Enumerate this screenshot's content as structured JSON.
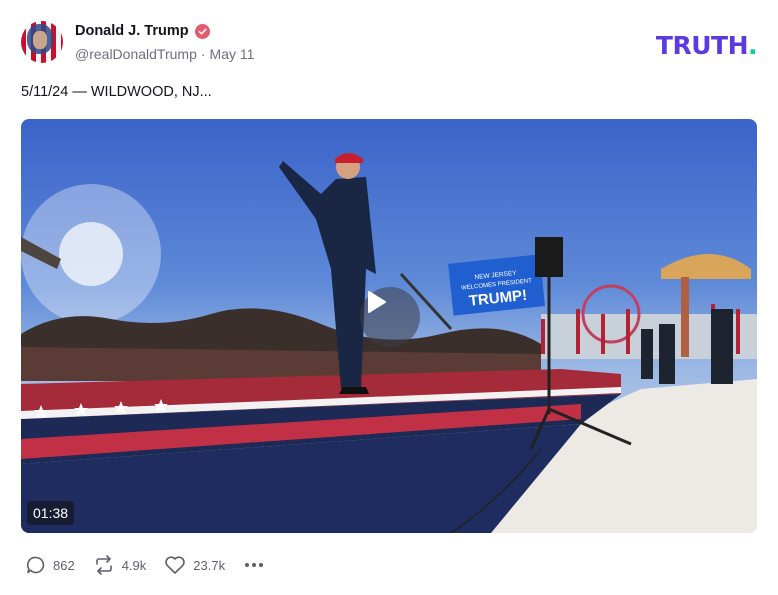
{
  "post": {
    "author_name": "Donald J. Trump",
    "handle": "@realDonaldTrump",
    "separator": "·",
    "date": "May 11",
    "text": "5/11/24 — WILDWOOD, NJ...",
    "verified_icon": "verified-badge-icon",
    "avatar_icon": "avatar"
  },
  "brand": {
    "logo_text": "TRUTH",
    "logo_dot": ".",
    "primary_color": "#5b3be0",
    "dot_color": "#14c8a3"
  },
  "media": {
    "type": "video",
    "duration": "01:38",
    "sign_text": "NEW JERSEY WELCOMES PRESIDENT TRUMP!",
    "play_icon": "play-icon"
  },
  "actions": {
    "replies": {
      "icon": "reply-icon",
      "count": "862"
    },
    "retruths": {
      "icon": "retruth-icon",
      "count": "4.9k"
    },
    "likes": {
      "icon": "heart-icon",
      "count": "23.7k"
    },
    "more": {
      "icon": "more-icon"
    }
  }
}
